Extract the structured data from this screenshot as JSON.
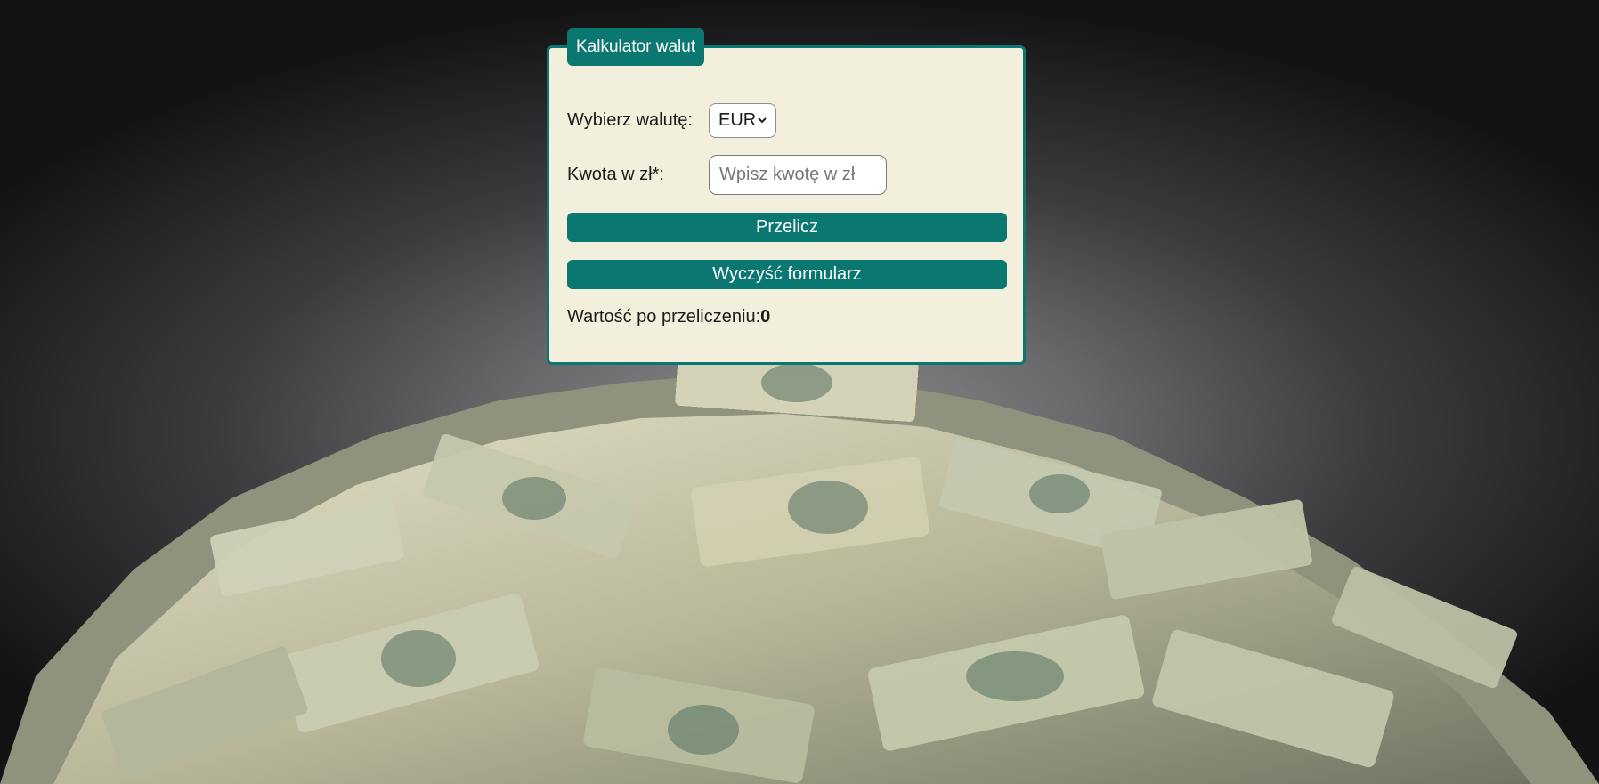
{
  "calculator": {
    "title": "Kalkulator walut",
    "currency_label": "Wybierz walutę:",
    "currency_selected": "EUR",
    "amount_label": "Kwota w zł*:",
    "amount_placeholder": "Wpisz kwotę w zł",
    "amount_value": "",
    "convert_button": "Przelicz",
    "clear_button": "Wyczyść formularz",
    "result_label": "Wartość po przeliczeniu:",
    "result_value": "0"
  },
  "colors": {
    "accent": "#0b7771",
    "panel_background": "#f2efdc"
  },
  "background": {
    "image": "pile-of-dollar-banknotes"
  }
}
